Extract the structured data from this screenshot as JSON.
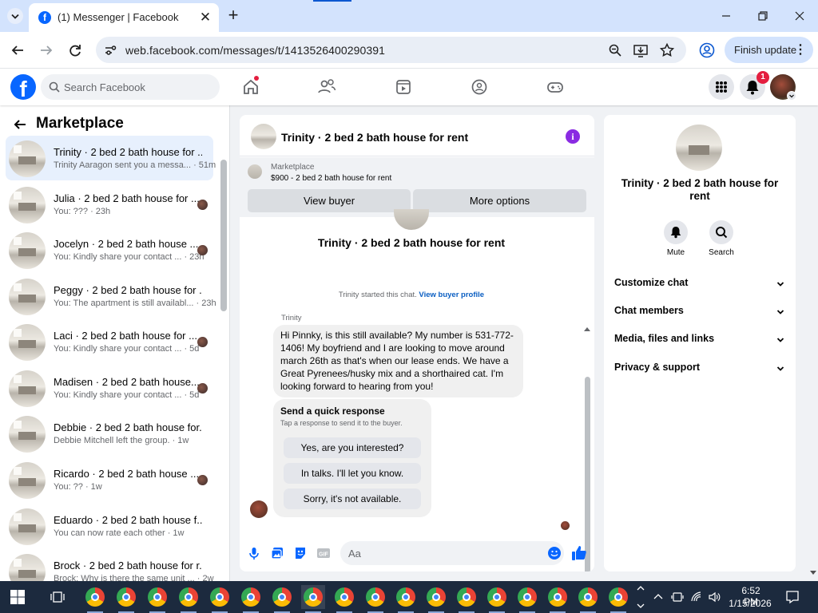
{
  "browser": {
    "tab_title": "(1) Messenger | Facebook",
    "url": "web.facebook.com/messages/t/1413526400290391",
    "update_button": "Finish update"
  },
  "fb_header": {
    "search_placeholder": "Search Facebook",
    "notification_count": "1",
    "brand_color": "#0866ff"
  },
  "sidebar": {
    "title": "Marketplace",
    "conversations": [
      {
        "title": "Trinity · 2 bed 2 bath house for ...",
        "snippet": "Trinity Aaragon sent you a messa... · 51m",
        "active": true
      },
      {
        "title": "Julia · 2 bed 2 bath house for ...",
        "snippet": "You: ??? · 23h"
      },
      {
        "title": "Jocelyn · 2 bed 2 bath house ...",
        "snippet": "You: Kindly share your contact ... · 23h"
      },
      {
        "title": "Peggy · 2 bed 2 bath house for ...",
        "snippet": "You: The apartment is still availabl... · 23h"
      },
      {
        "title": "Laci · 2 bed 2 bath house for ...",
        "snippet": "You: Kindly share your contact ... · 5d"
      },
      {
        "title": "Madisen · 2 bed 2 bath house...",
        "snippet": "You: Kindly share your contact ... · 5d"
      },
      {
        "title": "Debbie · 2 bed 2 bath house for...",
        "snippet": "Debbie Mitchell left the group. · 1w"
      },
      {
        "title": "Ricardo · 2 bed 2 bath house ...",
        "snippet": "You: ?? · 1w"
      },
      {
        "title": "Eduardo · 2 bed 2 bath house f...",
        "snippet": "You can now rate each other · 1w"
      },
      {
        "title": "Brock · 2 bed 2 bath house for r...",
        "snippet": "Brock: Why is there the same unit ... · 2w"
      }
    ]
  },
  "chat": {
    "header_title": "Trinity · 2 bed 2 bath house for rent",
    "marketplace_label": "Marketplace",
    "listing": "$900 - 2 bed 2 bath house for rent",
    "view_buyer": "View buyer",
    "more_options": "More options",
    "intro_title": "Trinity · 2 bed 2 bath house for rent",
    "started_text": "Trinity started this chat.",
    "view_buyer_profile": "View buyer profile",
    "sender": "Trinity",
    "message": "Hi Pinnky, is this still available? My number is 531-772-1406! My boyfriend and I are looking to move around march 26th as that's when our lease ends. We have a Great Pyrenees/husky mix and a shorthaired cat. I'm looking forward to hearing from you!",
    "quick_title": "Send a quick response",
    "quick_subtitle": "Tap a response to send it to the buyer.",
    "quick_options": [
      "Yes, are you interested?",
      "In talks. I'll let you know.",
      "Sorry, it's not available."
    ],
    "input_placeholder": "Aa"
  },
  "info_panel": {
    "title": "Trinity · 2 bed 2 bath house for rent",
    "mute": "Mute",
    "search": "Search",
    "rows": [
      "Customize chat",
      "Chat members",
      "Media, files and links",
      "Privacy & support"
    ]
  },
  "taskbar": {
    "time": "6:52 PM",
    "date": "1/15/2026"
  }
}
